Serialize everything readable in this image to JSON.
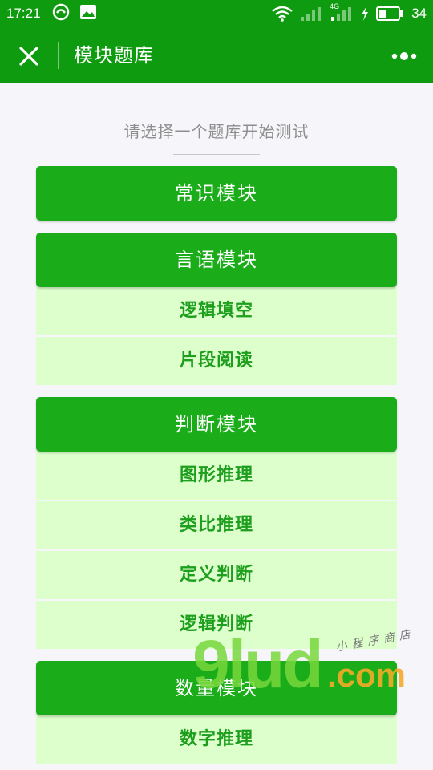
{
  "status_bar": {
    "time": "17:21",
    "network_type": "4G",
    "battery_level": "34"
  },
  "nav": {
    "title": "模块题库"
  },
  "prompt": "请选择一个题库开始测试",
  "modules": [
    {
      "label": "常识模块",
      "items": []
    },
    {
      "label": "言语模块",
      "items": [
        "逻辑填空",
        "片段阅读"
      ]
    },
    {
      "label": "判断模块",
      "items": [
        "图形推理",
        "类比推理",
        "定义判断",
        "逻辑判断"
      ]
    },
    {
      "label": "数量模块",
      "items": [
        "数字推理"
      ]
    }
  ],
  "watermark": {
    "logo": "9lud",
    "suffix": ".com",
    "text": "小程序商店"
  },
  "colors": {
    "header": "#0f9b0f",
    "module_button": "#1aad19",
    "sub_item_bg": "#dcffcc",
    "sub_item_text": "#1d9e1d"
  },
  "icons": [
    "close-icon",
    "more-icon",
    "wifi-icon",
    "signal-icon",
    "battery-icon",
    "charging-icon"
  ]
}
